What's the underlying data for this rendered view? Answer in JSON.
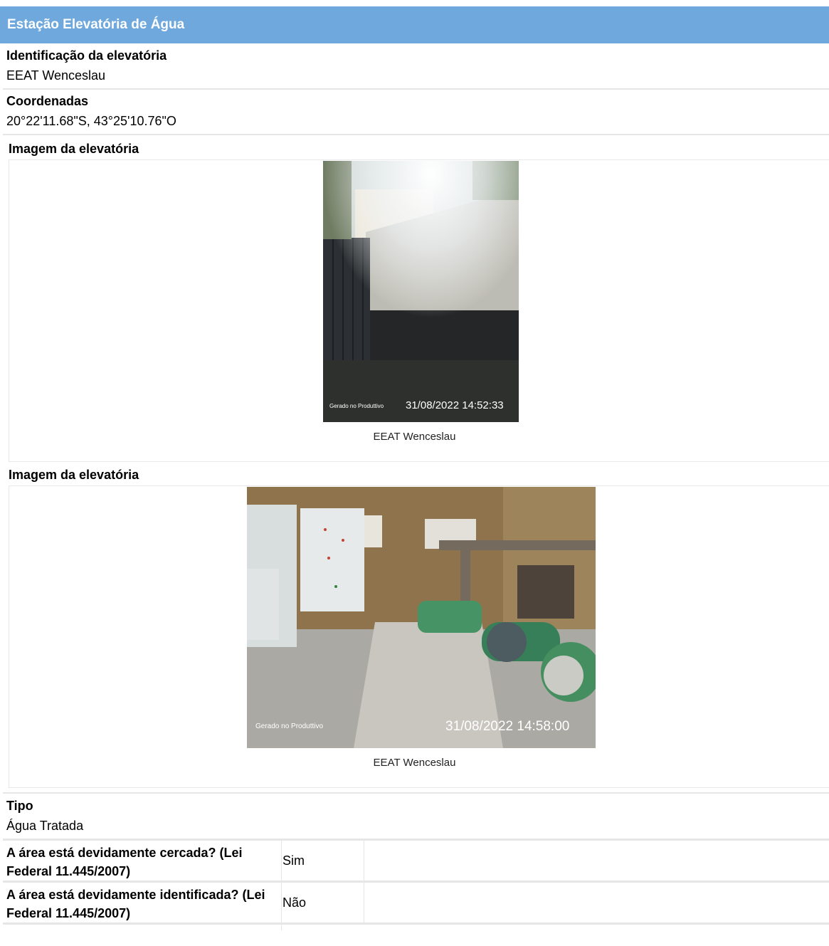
{
  "header": {
    "title": "Estação Elevatória de Água"
  },
  "fields": {
    "identificacao": {
      "label": "Identificação da elevatória",
      "value": "EEAT Wenceslau"
    },
    "coordenadas": {
      "label": "Coordenadas",
      "value": "20°22'11.68\"S, 43°25'10.76\"O"
    },
    "tipo": {
      "label": "Tipo",
      "value": "Água Tratada"
    }
  },
  "images": [
    {
      "label": "Imagem da elevatória",
      "stamp_app": "Gerado no Produttivo",
      "stamp_date": "31/08/2022 14:52:33",
      "caption": "EEAT Wenceslau"
    },
    {
      "label": "Imagem da elevatória",
      "stamp_app": "Gerado no Produttivo",
      "stamp_date": "31/08/2022 14:58:00",
      "caption": "EEAT Wenceslau"
    }
  ],
  "questions": [
    {
      "question": "A área está devidamente cercada? (Lei Federal 11.445/2007)",
      "answer": "Sim"
    },
    {
      "question": "A área está devidamente identificada? (Lei Federal 11.445/2007)",
      "answer": "Não"
    }
  ]
}
